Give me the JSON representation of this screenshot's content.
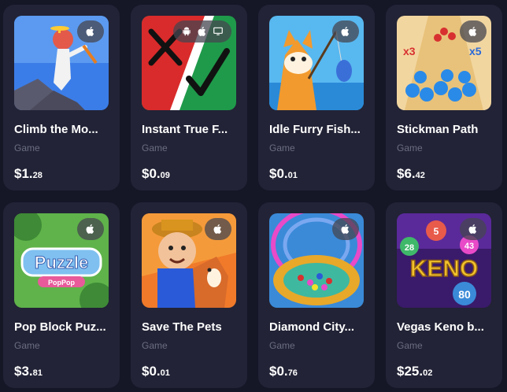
{
  "games": [
    {
      "title": "Climb the Mo...",
      "category": "Game",
      "price_main": "$1.",
      "price_cents": "28",
      "platforms": [
        "apple-icon"
      ]
    },
    {
      "title": "Instant True F...",
      "category": "Game",
      "price_main": "$0.",
      "price_cents": "09",
      "platforms": [
        "android-icon",
        "apple-icon",
        "desktop-icon"
      ]
    },
    {
      "title": "Idle Furry Fish...",
      "category": "Game",
      "price_main": "$0.",
      "price_cents": "01",
      "platforms": [
        "apple-icon"
      ]
    },
    {
      "title": "Stickman Path",
      "category": "Game",
      "price_main": "$6.",
      "price_cents": "42",
      "platforms": [
        "apple-icon"
      ]
    },
    {
      "title": "Pop Block Puz...",
      "category": "Game",
      "price_main": "$3.",
      "price_cents": "81",
      "platforms": [
        "apple-icon"
      ]
    },
    {
      "title": "Save The Pets",
      "category": "Game",
      "price_main": "$0.",
      "price_cents": "01",
      "platforms": [
        "apple-icon"
      ]
    },
    {
      "title": "Diamond City...",
      "category": "Game",
      "price_main": "$0.",
      "price_cents": "76",
      "platforms": [
        "apple-icon"
      ]
    },
    {
      "title": "Vegas Keno b...",
      "category": "Game",
      "price_main": "$25.",
      "price_cents": "02",
      "platforms": [
        "apple-icon"
      ]
    }
  ],
  "thumb_text": {
    "puzzle_word": "Puzzle",
    "puzzle_sub": "PopPop",
    "stickman_x3": "x3",
    "stickman_x5": "x5",
    "keno_word": "KENO",
    "keno_28": "28",
    "keno_5": "5",
    "keno_43": "43",
    "keno_80": "80"
  },
  "colors": {
    "background": "#151626",
    "card": "#222336",
    "category_text": "#6b6d80"
  }
}
